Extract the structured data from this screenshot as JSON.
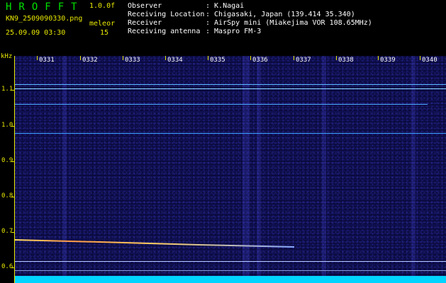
{
  "header": {
    "app_title": "HROFFT",
    "version": "1.0.0f",
    "file_name": "KN9_2509090330.png",
    "mode": "meleor",
    "datetime": "25.09.09 03:30",
    "count": "15",
    "meta": [
      {
        "key": "Observer",
        "value": ": K.Nagai"
      },
      {
        "key": "Receiving Location",
        "value": ": Chigasaki, Japan (139.414 35.340)"
      },
      {
        "key": "Receiver",
        "value": ": AirSpy mini (Miakejima VOR 108.65MHz)"
      },
      {
        "key": "Receiving antenna",
        "value": ": Maspro FM-3"
      }
    ]
  },
  "axis": {
    "unit": "kHz",
    "time_labels": [
      "0331",
      "0332",
      "0333",
      "0334",
      "0335",
      "0336",
      "0337",
      "0338",
      "0339",
      "0340"
    ],
    "freq_labels": [
      "1.1",
      "1.0",
      "0.9",
      "0.8",
      "0.7",
      "0.6"
    ]
  },
  "colors": {
    "text_yellow": "#e8e800",
    "title_green": "#00e000",
    "noise_cyan": "#00d4ff",
    "background": "#0a0a3c"
  }
}
